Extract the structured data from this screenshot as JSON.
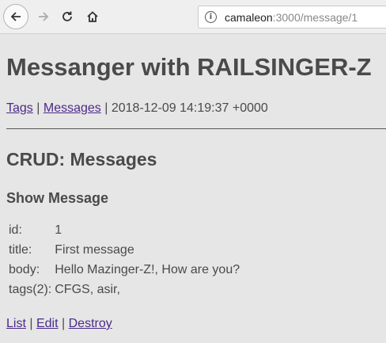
{
  "browser": {
    "url_host": "camaleon",
    "url_path": ":3000/message/1"
  },
  "header": {
    "title": "Messanger with RAILSINGER-Z",
    "nav": {
      "tags_link": "Tags",
      "messages_link": "Messages",
      "separator": "|",
      "timestamp": "2018-12-09 14:19:37 +0000"
    }
  },
  "main": {
    "section_title": "CRUD: Messages",
    "subtitle": "Show Message",
    "fields": [
      {
        "label": "id:",
        "value": "1"
      },
      {
        "label": "title:",
        "value": "First message"
      },
      {
        "label": "body:",
        "value": "Hello Mazinger-Z!, How are you?"
      },
      {
        "label": "tags(2):",
        "value": "CFGS, asir,"
      }
    ],
    "actions": {
      "list": "List",
      "edit": "Edit",
      "destroy": "Destroy",
      "separator": "|"
    }
  }
}
